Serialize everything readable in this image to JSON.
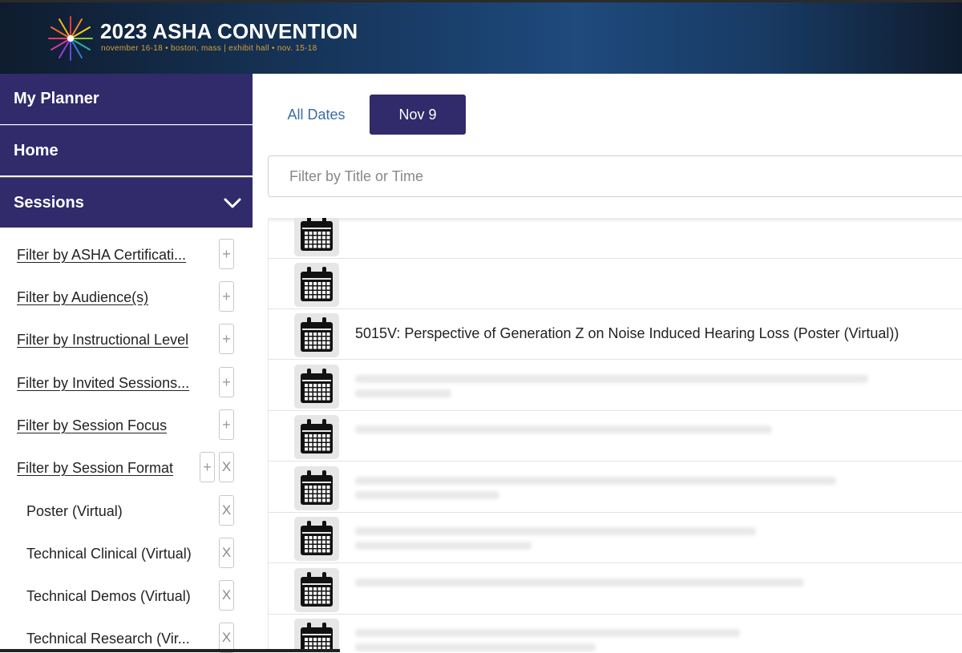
{
  "header": {
    "title": "2023 ASHA CONVENTION",
    "subtitle": "november 16-18 • boston, mass  |  exhibit hall • nov. 15-18"
  },
  "nav": {
    "planner": "My Planner",
    "home": "Home",
    "sessions": "Sessions"
  },
  "filters": [
    "Filter by ASHA Certificati...",
    "Filter by Audience(s)",
    "Filter by Instructional Level",
    "Filter by Invited Sessions...",
    "Filter by Session Focus",
    "Filter by Session Format"
  ],
  "selected_formats": [
    "Poster (Virtual)",
    "Technical Clinical (Virtual)",
    "Technical Demos (Virtual)",
    "Technical Research (Vir..."
  ],
  "buttons": {
    "plus": "+",
    "remove": "X"
  },
  "tabs": {
    "all_dates": "All Dates",
    "active_date": "Nov 9"
  },
  "search": {
    "placeholder": "Filter by Title or Time"
  },
  "sessions": [
    "",
    "",
    "5015V: Perspective of Generation Z on Noise Induced Hearing Loss (Poster (Virtual))",
    "",
    "",
    "",
    "",
    "",
    ""
  ],
  "colors": {
    "nav_bg": "#312a6b",
    "accent_link": "#3a6ea5",
    "header_bg": "#183a63"
  }
}
